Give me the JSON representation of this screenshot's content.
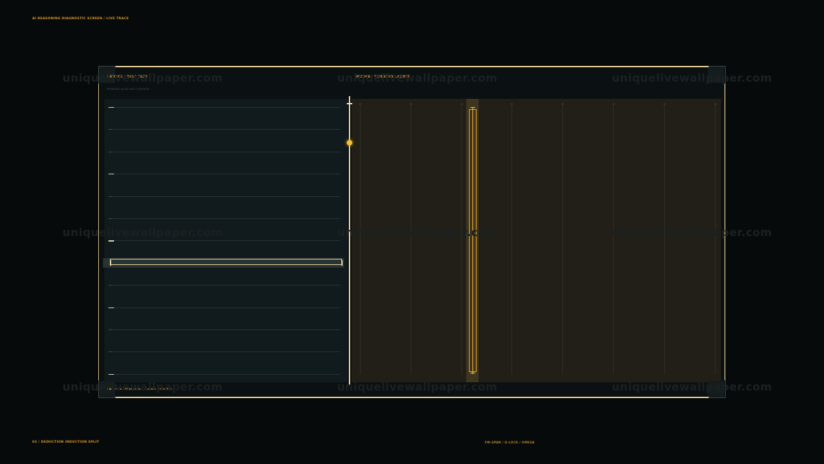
{
  "header": {
    "caption": "AI REASONING DIAGNOSTIC SCREEN / LIVE TRACE"
  },
  "left_panel": {
    "title": "DEDUCE / RULE TAPE",
    "subtitle": "PREMISES ALIGN INTO THEOREM"
  },
  "right_panel": {
    "title": "INDUCE / EVIDENCE LADDER"
  },
  "status": {
    "text": "RB4 → C2  FW-SPAN 4.2  Q-LOCK  OMEGA-9"
  },
  "footer": {
    "left": "03 / DEDUCTION INDUCTION SPLIT",
    "right": "FW-SPAN / Q-LOCK / OMEGA"
  },
  "watermark": {
    "text": "uniquelivewallpaper.com"
  },
  "colors": {
    "accent": "#e3a52b",
    "frame": "#e6cf96",
    "left_bg": "#111a1d",
    "right_bg": "#211f17",
    "background": "#070a0a"
  }
}
